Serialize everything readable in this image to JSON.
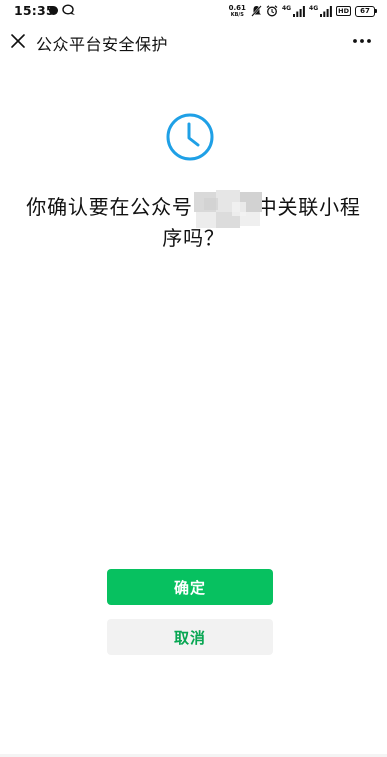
{
  "status_bar": {
    "time": "15:35",
    "net_speed_value": "0.61",
    "net_speed_unit": "KB/S",
    "signal_label_1": "4G",
    "signal_label_2": "4G",
    "hd_label": "HD",
    "battery": "67",
    "icons": [
      "notification-dot-icon",
      "chat-bubble-icon",
      "mute-icon",
      "alarm-icon",
      "signal-icon",
      "signal-icon",
      "battery-icon"
    ]
  },
  "header": {
    "title": "公众平台安全保护",
    "close_icon": "close-icon",
    "more_icon": "more-icon"
  },
  "main": {
    "icon": "clock-icon",
    "question_part1": "你确认要在公众号",
    "question_redacted": "",
    "question_part2": "中关联小程序吗？"
  },
  "buttons": {
    "confirm_label": "确定",
    "cancel_label": "取消"
  },
  "colors": {
    "primary": "#07c160",
    "cancel_text": "#07a652",
    "cancel_bg": "#f2f2f2",
    "clock_stroke": "#1fa0e6"
  }
}
